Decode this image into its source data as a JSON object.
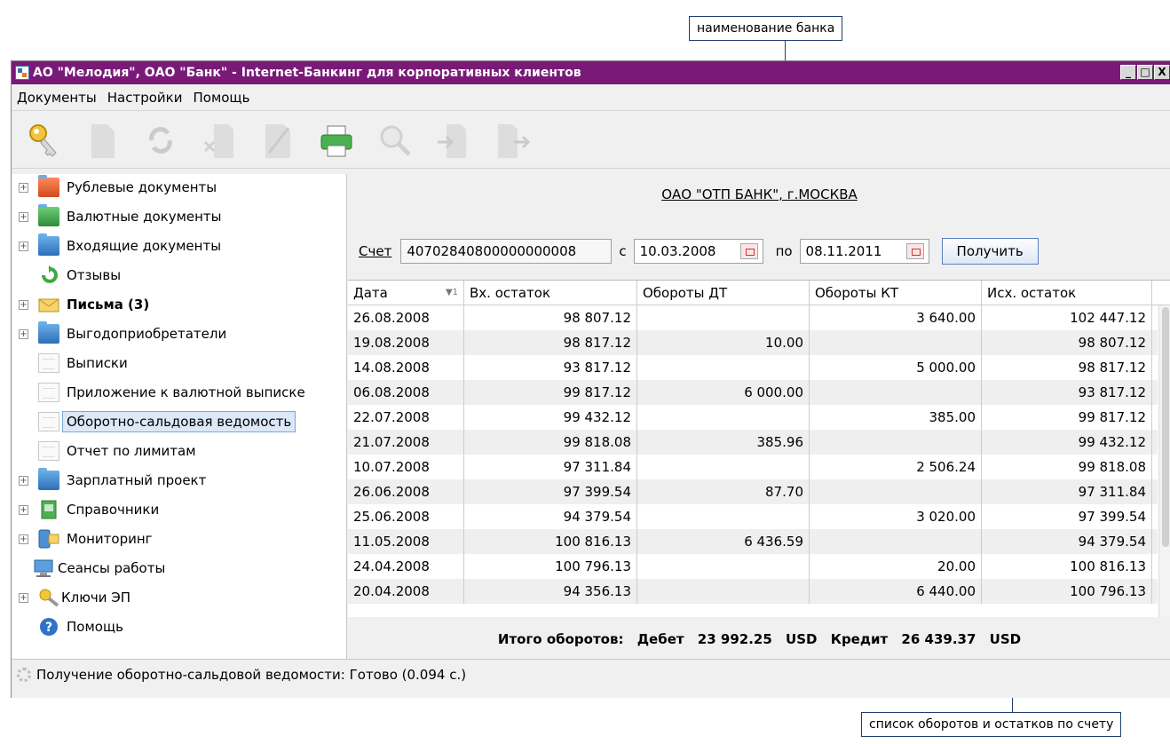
{
  "callouts": {
    "bank_name": "наименование банка",
    "turnover_list": "список оборотов и остатков по счету"
  },
  "window": {
    "title": "АО \"Мелодия\", ОАО \"Банк\" - Internet-Банкинг для корпоративных клиентов",
    "controls": [
      "_",
      "□",
      "X"
    ]
  },
  "menu": [
    "Документы",
    "Настройки",
    "Помощь"
  ],
  "toolbar": [
    "key-icon",
    "new-document-icon",
    "refresh-icon",
    "delete-icon",
    "sign-icon",
    "printer-icon",
    "search-icon",
    "import-icon",
    "export-icon"
  ],
  "sidebar": {
    "items": [
      {
        "label": "Рублевые документы",
        "icon": "ruble-folder-icon",
        "expandable": true,
        "bold": false
      },
      {
        "label": "Валютные документы",
        "icon": "currency-folder-icon",
        "expandable": true,
        "bold": false
      },
      {
        "label": "Входящие документы",
        "icon": "incoming-folder-icon",
        "expandable": true,
        "bold": false
      },
      {
        "label": "Отзывы",
        "icon": "recall-icon",
        "expandable": false,
        "bold": false
      },
      {
        "label": "Письма (3)",
        "icon": "mail-icon",
        "expandable": true,
        "bold": true
      },
      {
        "label": "Выгодоприобретатели",
        "icon": "folder-icon",
        "expandable": true,
        "bold": false
      },
      {
        "label": "Выписки",
        "icon": "document-icon",
        "expandable": false,
        "bold": false
      },
      {
        "label": "Приложение к валютной выписке",
        "icon": "document-icon",
        "expandable": false,
        "bold": false
      },
      {
        "label": "Оборотно-сальдовая ведомость",
        "icon": "document-icon",
        "expandable": false,
        "bold": false,
        "selected": true
      },
      {
        "label": "Отчет по лимитам",
        "icon": "document-icon",
        "expandable": false,
        "bold": false
      },
      {
        "label": "Зарплатный проект",
        "icon": "folder-icon",
        "expandable": true,
        "bold": false
      },
      {
        "label": "Справочники",
        "icon": "book-icon",
        "expandable": true,
        "bold": false
      },
      {
        "label": "Мониторинг",
        "icon": "monitoring-icon",
        "expandable": true,
        "bold": false
      },
      {
        "label": "Сеансы работы",
        "icon": "computer-icon",
        "expandable": false,
        "bold": false
      },
      {
        "label": "Ключи ЭП",
        "icon": "keys-icon",
        "expandable": true,
        "bold": false
      },
      {
        "label": "Помощь",
        "icon": "help-icon",
        "expandable": false,
        "bold": false
      }
    ]
  },
  "main": {
    "bank": "ОАО \"ОТП БАНК\", г.МОСКВА",
    "filter": {
      "account_label": "Счет",
      "account_value": "40702840800000000008",
      "from_label": "с",
      "from_value": "10.03.2008",
      "to_label": "по",
      "to_value": "08.11.2011",
      "get_button": "Получить"
    },
    "table": {
      "columns": [
        "Дата",
        "Вх. остаток",
        "Обороты ДТ",
        "Обороты КТ",
        "Исх. остаток"
      ],
      "sort_marker": "▼1",
      "rows": [
        [
          "26.08.2008",
          "98 807.12",
          "",
          "3 640.00",
          "102 447.12"
        ],
        [
          "19.08.2008",
          "98 817.12",
          "10.00",
          "",
          "98 807.12"
        ],
        [
          "14.08.2008",
          "93 817.12",
          "",
          "5 000.00",
          "98 817.12"
        ],
        [
          "06.08.2008",
          "99 817.12",
          "6 000.00",
          "",
          "93 817.12"
        ],
        [
          "22.07.2008",
          "99 432.12",
          "",
          "385.00",
          "99 817.12"
        ],
        [
          "21.07.2008",
          "99 818.08",
          "385.96",
          "",
          "99 432.12"
        ],
        [
          "10.07.2008",
          "97 311.84",
          "",
          "2 506.24",
          "99 818.08"
        ],
        [
          "26.06.2008",
          "97 399.54",
          "87.70",
          "",
          "97 311.84"
        ],
        [
          "25.06.2008",
          "94 379.54",
          "",
          "3 020.00",
          "97 399.54"
        ],
        [
          "11.05.2008",
          "100 816.13",
          "6 436.59",
          "",
          "94 379.54"
        ],
        [
          "24.04.2008",
          "100 796.13",
          "",
          "20.00",
          "100 816.13"
        ],
        [
          "20.04.2008",
          "94 356.13",
          "",
          "6 440.00",
          "100 796.13"
        ]
      ]
    },
    "totals": {
      "label": "Итого оборотов:",
      "debit_label": "Дебет",
      "debit_value": "23 992.25",
      "debit_currency": "USD",
      "credit_label": "Кредит",
      "credit_value": "26 439.37",
      "credit_currency": "USD"
    }
  },
  "status": "Получение оборотно-сальдовой ведомости: Готово (0.094 с.)"
}
